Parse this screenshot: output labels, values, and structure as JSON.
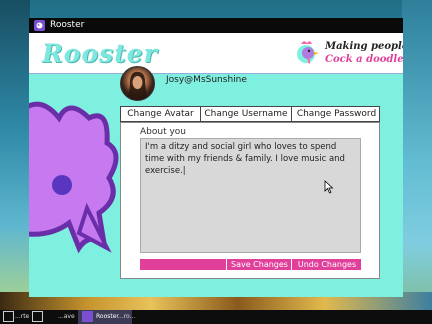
{
  "window": {
    "title": "Rooster"
  },
  "header": {
    "logo": "Rooster",
    "tagline_line1": "Making people go",
    "tagline_line2": "Cock a doodle doo"
  },
  "profile": {
    "handle": "Josy@MsSunshine"
  },
  "tabs": [
    {
      "label": "Change Avatar"
    },
    {
      "label": "Change Username"
    },
    {
      "label": "Change Password"
    }
  ],
  "about": {
    "label": "About you",
    "text": "I'm a ditzy and social girl who loves to spend time with my friends & family. I love music and exercise.|"
  },
  "actions": {
    "save_label": "Save Changes",
    "undo_label": "Undo Changes"
  },
  "taskbar": {
    "items": [
      {
        "label": "...rte"
      },
      {
        "label": "...ave"
      },
      {
        "label": "Rooster"
      },
      {
        "label": "...ro..."
      }
    ]
  },
  "colors": {
    "accent": "#e0409a",
    "background": "#7ff0df",
    "logo": "#7ee8e0"
  },
  "icons": {
    "app": "rooster-icon",
    "cursor": "mouse-pointer-icon"
  }
}
